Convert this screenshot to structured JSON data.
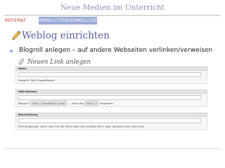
{
  "slide": {
    "title": "Neue Medien im Unterricht",
    "tag": "REFERAT",
    "url_tag": "WWW.LITERATENMELU.DE"
  },
  "heading": {
    "text": "Weblog einrichten"
  },
  "bullet": {
    "text": "Blogroll anlegen – auf andere Webseiten verlinken/verweisen"
  },
  "link_form": {
    "title": "Neuen Link anlegen",
    "name_section": {
      "label": "Name",
      "value": "",
      "hint": "Beispiel: Tolle Blogsoftware"
    },
    "address_section": {
      "label": "Web-Adresse",
      "value": "",
      "hint_prefix": "Beispiel:",
      "hint_code1": "http://wordpress.org/",
      "hint_middle": "— nicht das",
      "hint_code2": "http://",
      "hint_suffix": "vergessen"
    },
    "description_section": {
      "label": "Beschreibung",
      "value": "",
      "hint": "Wird angezeigt, wenn man mit der Maus über die Linkliste fährt, oder optional unter dem Link."
    }
  },
  "colors": {
    "title": "#8a8fb6",
    "tag_red": "#c0392b",
    "url_tag_bg": "#9aa8d8",
    "heading": "#5a5f9f",
    "bullet": "#8da7d9"
  }
}
